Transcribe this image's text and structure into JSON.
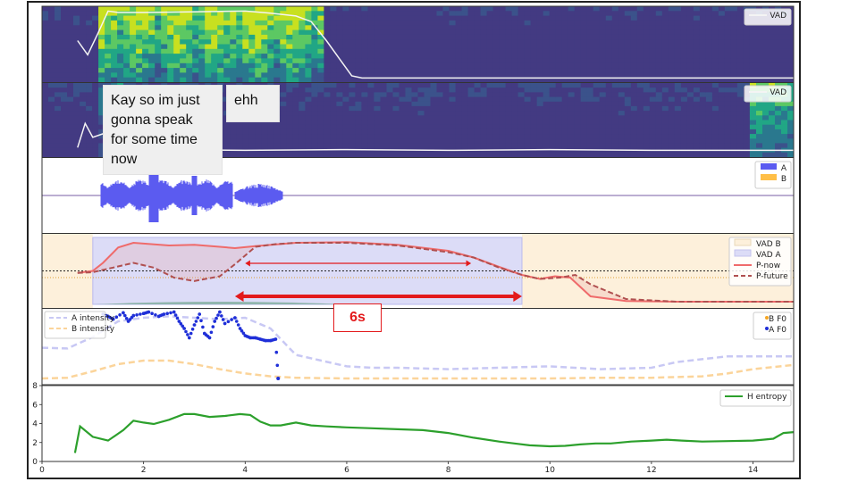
{
  "annotations": {
    "transcript_a": "Kay so im just\ngonna speak\nfor some time\nnow",
    "transcript_b": "ehh",
    "duration_label": "6s"
  },
  "colors": {
    "a": "#5b5bf0",
    "b": "#ffbf47",
    "p_now": "#ef6b6b",
    "p_future": "#b05050",
    "entropy": "#2ca02c",
    "arrow": "#e31a1c"
  },
  "chart_data": [
    {
      "type": "heatmap",
      "panel": "spectrogram-a",
      "legend": [
        "VAD"
      ],
      "vad_line": {
        "x": [
          0.7,
          0.9,
          1.1,
          1.3,
          1.5,
          2.0,
          3.0,
          4.0,
          4.5,
          5.0,
          5.3,
          5.6,
          5.9,
          6.1,
          6.3,
          7.0,
          10.0,
          14.8
        ],
        "y": [
          0.55,
          0.35,
          0.65,
          0.97,
          0.95,
          0.95,
          0.96,
          0.97,
          0.94,
          0.9,
          0.82,
          0.55,
          0.25,
          0.05,
          0.02,
          0.02,
          0.02,
          0.02
        ]
      }
    },
    {
      "type": "heatmap",
      "panel": "spectrogram-b",
      "legend": [
        "VAD"
      ],
      "vad_line": {
        "x": [
          0.7,
          0.85,
          1.0,
          1.2,
          1.5,
          2.5,
          4.0,
          6.0,
          8.0,
          10.0,
          12.0,
          14.8
        ],
        "y": [
          0.1,
          0.45,
          0.25,
          0.3,
          0.12,
          0.07,
          0.06,
          0.07,
          0.06,
          0.07,
          0.06,
          0.06
        ]
      }
    },
    {
      "type": "area",
      "panel": "waveform",
      "legend": [
        "A",
        "B"
      ]
    },
    {
      "type": "line",
      "panel": "vad-probabilities",
      "legend": [
        "VAD B",
        "VAD A",
        "P-now",
        "P-future"
      ],
      "vad_a_span": [
        1.0,
        9.45
      ],
      "vad_b_spans": [
        [
          0.0,
          1.0
        ],
        [
          9.45,
          14.8
        ]
      ],
      "series": [
        {
          "name": "P-now",
          "x": [
            0.7,
            1.0,
            1.2,
            1.5,
            1.8,
            2.5,
            3.0,
            3.5,
            3.8,
            4.2,
            5.0,
            6.0,
            7.0,
            8.0,
            8.5,
            9.0,
            9.45,
            9.8,
            10.1,
            10.4,
            10.8,
            11.5,
            12.5,
            14.8
          ],
          "y": [
            0.47,
            0.5,
            0.62,
            0.85,
            0.92,
            0.88,
            0.89,
            0.86,
            0.84,
            0.87,
            0.92,
            0.93,
            0.89,
            0.8,
            0.7,
            0.56,
            0.44,
            0.38,
            0.42,
            0.4,
            0.12,
            0.05,
            0.04,
            0.04
          ]
        },
        {
          "name": "P-future",
          "x": [
            0.7,
            1.0,
            1.4,
            1.8,
            2.2,
            2.6,
            3.0,
            3.5,
            3.8,
            4.2,
            4.6,
            5.0,
            6.0,
            7.0,
            8.0,
            8.5,
            9.0,
            9.45,
            9.8,
            10.2,
            10.5,
            10.8,
            11.5,
            12.5,
            14.8
          ],
          "y": [
            0.47,
            0.48,
            0.55,
            0.62,
            0.55,
            0.4,
            0.35,
            0.42,
            0.6,
            0.86,
            0.9,
            0.92,
            0.92,
            0.88,
            0.78,
            0.7,
            0.55,
            0.44,
            0.38,
            0.4,
            0.44,
            0.3,
            0.08,
            0.04,
            0.04
          ]
        }
      ]
    },
    {
      "type": "scatter",
      "panel": "prosody",
      "legend": [
        "A intensity",
        "B intensity",
        "B F0",
        "A F0"
      ],
      "series": [
        {
          "name": "A intensity",
          "x": [
            0.0,
            0.5,
            1.0,
            1.5,
            2.0,
            2.5,
            3.0,
            3.5,
            4.0,
            4.5,
            5.0,
            5.5,
            6.0,
            6.5,
            7.0,
            8.0,
            9.0,
            10.0,
            11.0,
            12.0,
            12.5,
            13.0,
            13.5,
            14.0,
            14.5,
            14.8
          ],
          "y": [
            0.48,
            0.47,
            0.63,
            0.85,
            0.9,
            0.92,
            0.9,
            0.88,
            0.9,
            0.75,
            0.38,
            0.3,
            0.22,
            0.2,
            0.2,
            0.18,
            0.2,
            0.22,
            0.18,
            0.2,
            0.28,
            0.32,
            0.36,
            0.36,
            0.36,
            0.36
          ]
        },
        {
          "name": "B intensity",
          "x": [
            0.0,
            0.5,
            1.0,
            1.5,
            2.0,
            2.5,
            3.0,
            3.5,
            4.0,
            4.5,
            5.0,
            6.0,
            7.0,
            8.0,
            9.0,
            10.0,
            11.0,
            12.0,
            13.0,
            13.5,
            14.0,
            14.8
          ],
          "y": [
            0.05,
            0.06,
            0.15,
            0.25,
            0.3,
            0.3,
            0.25,
            0.18,
            0.12,
            0.08,
            0.06,
            0.05,
            0.05,
            0.05,
            0.05,
            0.05,
            0.06,
            0.06,
            0.08,
            0.12,
            0.18,
            0.24
          ]
        },
        {
          "name": "A F0",
          "x": [
            1.2,
            1.3,
            1.4,
            1.6,
            1.7,
            1.8,
            2.0,
            2.1,
            2.3,
            2.4,
            2.6,
            2.7,
            2.8,
            2.9,
            3.0,
            3.1,
            3.2,
            3.3,
            3.4,
            3.5,
            3.6,
            3.8,
            3.9,
            4.0,
            4.1,
            4.2,
            4.3,
            4.4,
            4.5,
            4.6,
            4.65
          ],
          "y": [
            0.95,
            0.92,
            0.88,
            0.97,
            0.85,
            0.93,
            0.96,
            0.98,
            0.92,
            0.95,
            0.98,
            0.85,
            0.75,
            0.62,
            0.8,
            0.95,
            0.68,
            0.62,
            0.85,
            0.98,
            0.82,
            0.9,
            0.75,
            0.65,
            0.62,
            0.62,
            0.6,
            0.58,
            0.58,
            0.6,
            0.05
          ]
        },
        {
          "name": "B F0",
          "x": [],
          "y": []
        }
      ]
    },
    {
      "type": "line",
      "panel": "entropy",
      "legend": [
        "H entropy"
      ],
      "ylim": [
        0,
        8
      ],
      "xlim": [
        0,
        14.8
      ],
      "x_ticks": [
        0,
        2,
        4,
        6,
        8,
        10,
        12,
        14
      ],
      "y_ticks": [
        0,
        2,
        4,
        6,
        8
      ],
      "series": [
        {
          "name": "H entropy",
          "x": [
            0.65,
            0.75,
            1.0,
            1.3,
            1.6,
            1.8,
            2.0,
            2.2,
            2.5,
            2.8,
            3.0,
            3.3,
            3.6,
            3.9,
            4.1,
            4.3,
            4.5,
            4.7,
            5.0,
            5.3,
            5.6,
            6.0,
            6.5,
            7.0,
            7.5,
            8.0,
            8.5,
            9.0,
            9.3,
            9.6,
            10.0,
            10.3,
            10.6,
            10.9,
            11.2,
            11.6,
            12.0,
            12.3,
            12.6,
            13.0,
            13.5,
            14.0,
            14.2,
            14.4,
            14.6,
            14.8
          ],
          "y": [
            0.9,
            3.7,
            2.6,
            2.2,
            3.3,
            4.3,
            4.1,
            3.95,
            4.4,
            5.0,
            5.0,
            4.7,
            4.8,
            5.0,
            4.9,
            4.2,
            3.8,
            3.8,
            4.1,
            3.8,
            3.7,
            3.6,
            3.5,
            3.4,
            3.3,
            3.0,
            2.5,
            2.1,
            1.9,
            1.7,
            1.6,
            1.65,
            1.8,
            1.9,
            1.9,
            2.1,
            2.2,
            2.3,
            2.2,
            2.1,
            2.15,
            2.2,
            2.3,
            2.4,
            3.0,
            3.1
          ]
        }
      ]
    }
  ]
}
